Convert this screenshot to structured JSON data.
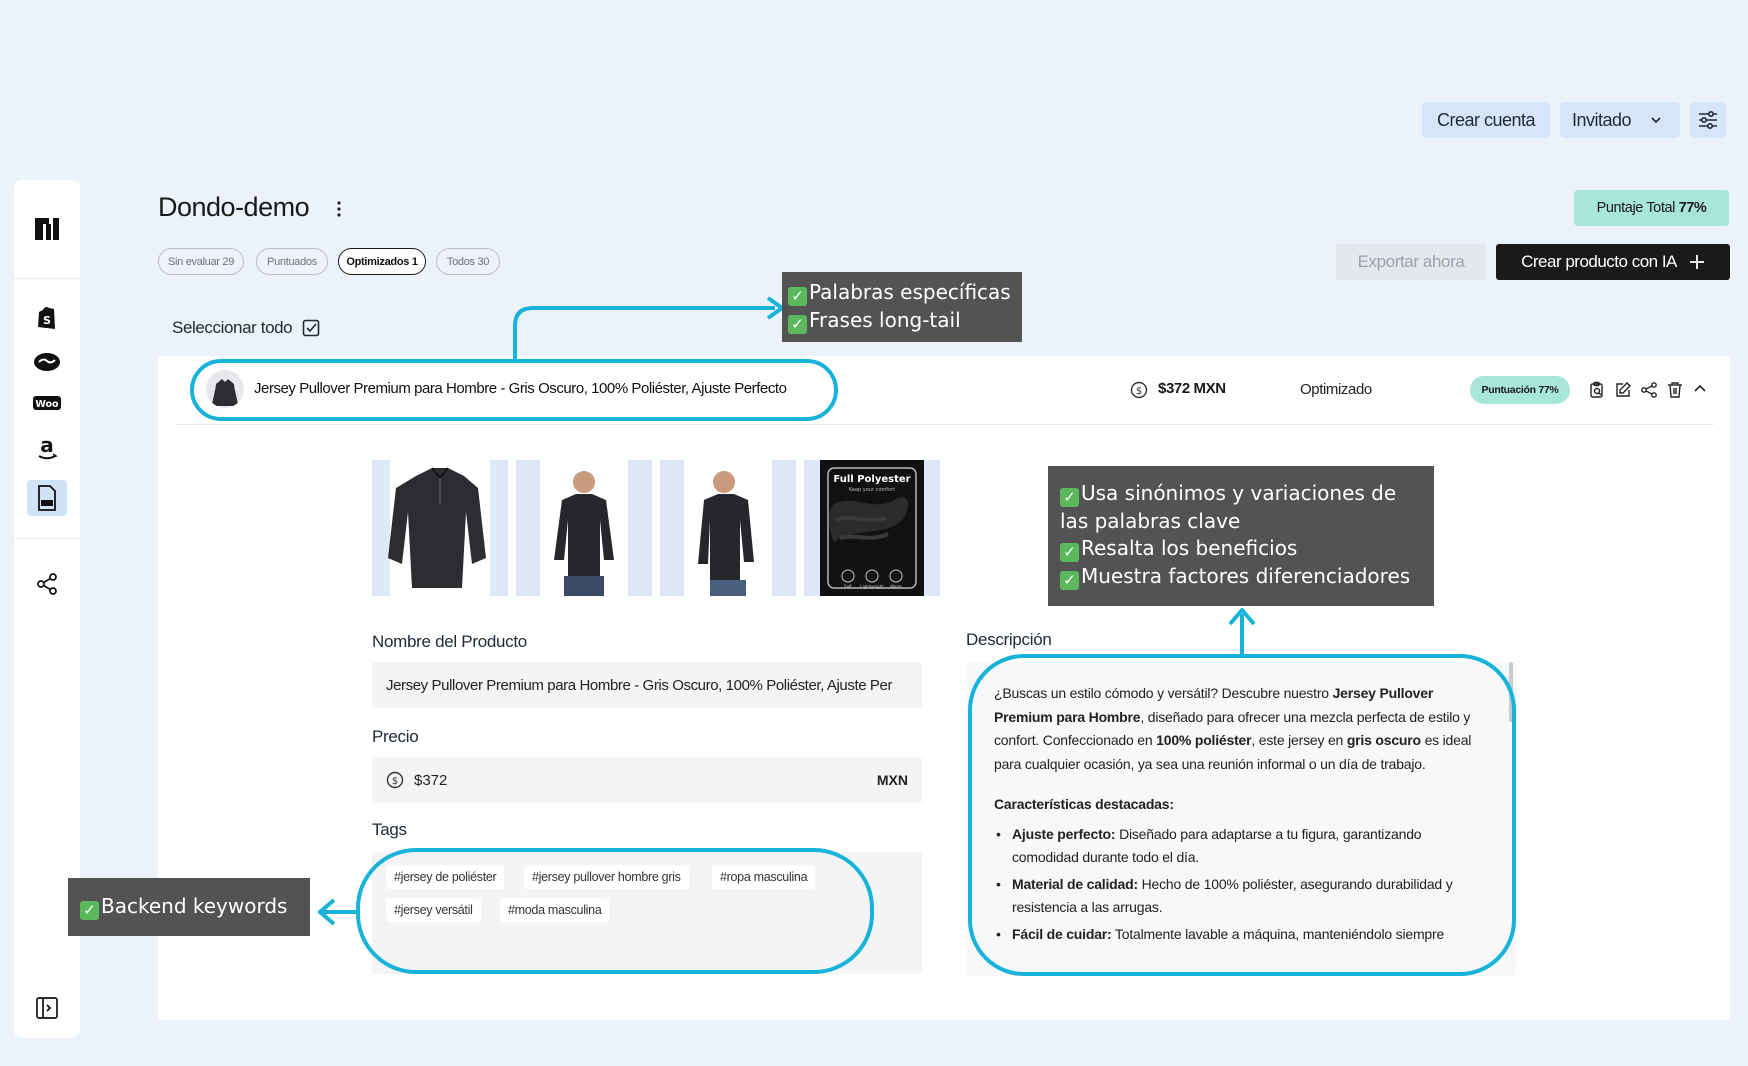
{
  "header": {
    "create_account": "Crear cuenta",
    "user_menu": "Invitado"
  },
  "page": {
    "title": "Dondo-demo",
    "score_prefix": "Puntaje Total ",
    "score_value": "77%"
  },
  "filters": [
    {
      "label": "Sin evaluar 29"
    },
    {
      "label": "Puntuados"
    },
    {
      "label": "Optimizados 1"
    },
    {
      "label": "Todos 30"
    }
  ],
  "actions": {
    "export": "Exportar ahora",
    "create_ai": "Crear producto con IA"
  },
  "select_all": "Seleccionar todo",
  "product": {
    "name": "Jersey Pullover Premium para Hombre - Gris Oscuro, 100% Poliéster, Ajuste Perfecto",
    "price_display": "$372 MXN",
    "status": "Optimizado",
    "score_badge": "Puntuación 77%",
    "image4_title": "Full Polyester",
    "image4_subtitle": "Keep your comfort",
    "image4_icons": [
      "Soft",
      "Lightweight",
      "Warm"
    ]
  },
  "form": {
    "name_label": "Nombre del Producto",
    "name_value": "Jersey Pullover Premium para Hombre - Gris Oscuro, 100% Poliéster, Ajuste Per",
    "price_label": "Precio",
    "price_value": "$372",
    "currency": "MXN",
    "tags_label": "Tags",
    "tags": [
      "#jersey de poliéster",
      "#jersey pullover hombre gris",
      "#ropa masculina",
      "#jersey versátil",
      "#moda masculina"
    ],
    "desc_label": "Descripción",
    "desc": {
      "p1a": "¿Buscas un estilo cómodo y versátil? Descubre nuestro ",
      "p1b": "Jersey Pullover Premium para Hombre",
      "p1c": ", diseñado para ofrecer una mezcla perfecta de estilo y confort. Confeccionado en ",
      "p1d": "100% poliéster",
      "p1e": ", este jersey en ",
      "p1f": "gris oscuro",
      "p1g": " es ideal para cualquier ocasión, ya sea una reunión informal o un día de trabajo.",
      "features_title": "Características destacadas:",
      "b1_title": "Ajuste perfecto:",
      "b1_text": " Diseñado para adaptarse a tu figura, garantizando comodidad durante todo el día.",
      "b2_title": "Material de calidad:",
      "b2_text": " Hecho de 100% poliéster, asegurando durabilidad y resistencia a las arrugas.",
      "b3_title": "Fácil de cuidar:",
      "b3_text": " Totalmente lavable a máquina, manteniéndolo siempre"
    }
  },
  "annotations": {
    "title_note": [
      "Palabras específicas",
      "Frases long-tail"
    ],
    "desc_note": [
      "Usa sinónimos y variaciones de las palabras clave",
      "Resalta los beneficios",
      "Muestra factores diferenciadores"
    ],
    "tags_note": [
      "Backend keywords"
    ],
    "check_glyph": "✓"
  },
  "colors": {
    "accent": "#17b3d8",
    "score_bg": "#a8e6d8",
    "dark_button": "#1a1a1a",
    "note_bg": "#535353"
  }
}
